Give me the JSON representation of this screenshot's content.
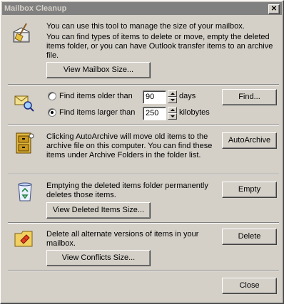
{
  "window": {
    "title": "Mailbox Cleanup",
    "close_glyph": "✕"
  },
  "intro": {
    "icon": "broom-mailbox-icon",
    "line1": "You can use this tool to manage the size of your mailbox.",
    "line2": "You can find types of items to delete or move, empty the deleted items folder, or you can have Outlook transfer items to an archive file.",
    "view_button": "View Mailbox Size..."
  },
  "find": {
    "icon": "find-items-icon",
    "older_label": "Find items older than",
    "older_value": "90",
    "older_unit": "days",
    "larger_label": "Find items larger than",
    "larger_value": "250",
    "larger_unit": "kilobytes",
    "selected": "larger",
    "find_button": "Find..."
  },
  "autoarchive": {
    "icon": "archive-cabinet-icon",
    "text": "Clicking AutoArchive will move old items to the archive file on this computer.  You can find these items under Archive Folders in the folder list.",
    "button": "AutoArchive"
  },
  "deleted": {
    "icon": "recycle-bin-icon",
    "text": "Emptying the deleted items folder permanently deletes those items.",
    "view_button": "View Deleted Items Size...",
    "empty_button": "Empty"
  },
  "conflicts": {
    "icon": "conflict-folder-icon",
    "text": "Delete all alternate versions of items in your mailbox.",
    "view_button": "View Conflicts Size...",
    "delete_button": "Delete"
  },
  "footer": {
    "close_button": "Close"
  }
}
